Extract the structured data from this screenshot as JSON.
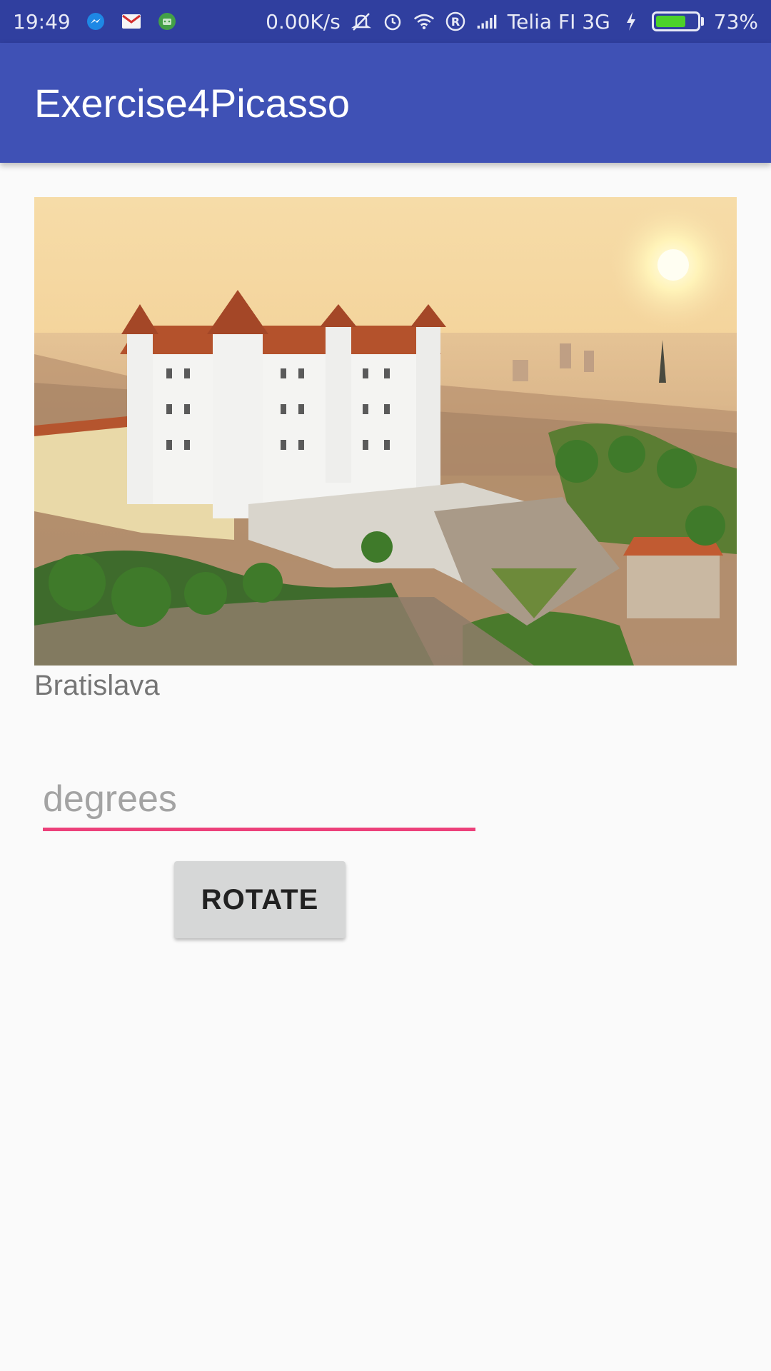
{
  "status_bar": {
    "time": "19:49",
    "net_speed": "0.00K/s",
    "carrier": "Telia FI 3G",
    "battery": "73%",
    "battery_level": 0.73,
    "icons": [
      "messenger-icon",
      "gmail-icon",
      "android-icon",
      "mute-icon",
      "alarm-icon",
      "wifi-icon",
      "roaming-icon",
      "signal-icon",
      "charging-icon",
      "battery-icon"
    ]
  },
  "app_bar": {
    "title": "Exercise4Picasso"
  },
  "image": {
    "caption": "Bratislava"
  },
  "degrees_input": {
    "value": "",
    "placeholder": "degrees"
  },
  "rotate_button": {
    "label": "ROTATE"
  },
  "colors": {
    "status_bar": "#303f9f",
    "primary": "#3f51b5",
    "accent": "#ec407a",
    "button": "#d6d7d7",
    "background": "#fafafa"
  }
}
